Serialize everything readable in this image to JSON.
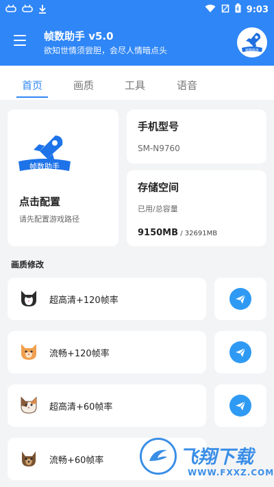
{
  "status_bar": {
    "time": "9:03",
    "left_icons": [
      "game-icon",
      "game-icon",
      "download-icon"
    ],
    "right_icons": [
      "wifi-icon",
      "sim-icon",
      "battery-icon"
    ]
  },
  "header": {
    "title": "帧数助手 v5.0",
    "subtitle": "欲知世情须尝胆，会尽人情暗点头",
    "logo_text": "帧数助手",
    "accent_color": "#2f86f6"
  },
  "tabs": [
    {
      "label": "首页",
      "active": true
    },
    {
      "label": "画质",
      "active": false
    },
    {
      "label": "工具",
      "active": false
    },
    {
      "label": "语音",
      "active": false
    }
  ],
  "config_card": {
    "logo_text": "帧数助手",
    "title": "点击配置",
    "subtitle": "请先配置游戏路径"
  },
  "model_card": {
    "label": "手机型号",
    "value": "SM-N9760"
  },
  "storage_card": {
    "label": "存储空间",
    "subtitle": "已用/总容量",
    "used": "9150MB",
    "total": " / 32691MB"
  },
  "quality_section": {
    "heading": "画质修改",
    "items": [
      {
        "label": "超高清+120帧率",
        "icon": "cat-tuxedo-icon"
      },
      {
        "label": "流畅+120帧率",
        "icon": "cat-orange-icon"
      },
      {
        "label": "超高清+60帧率",
        "icon": "cat-calico-icon"
      },
      {
        "label": "流畅+60帧率",
        "icon": "dog-icon"
      }
    ]
  },
  "watermark": {
    "brand": "飞翔下载",
    "url": "WWW.FXXZ.COM"
  }
}
